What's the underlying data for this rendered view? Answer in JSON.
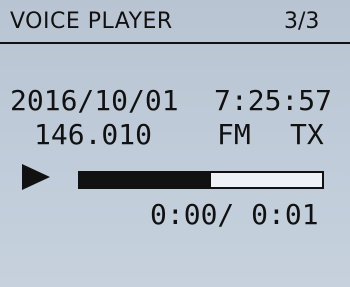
{
  "header": {
    "title": "VOICE PLAYER",
    "page_indicator": "3/3"
  },
  "recording": {
    "date": "2016/10/01",
    "time": "7:25:57",
    "frequency": "146.010",
    "mode": "FM",
    "tx_rx": "TX"
  },
  "playback": {
    "state_icon": "play-icon",
    "progress_fraction": 0.54,
    "elapsed_display": "0:00/ 0:01"
  }
}
